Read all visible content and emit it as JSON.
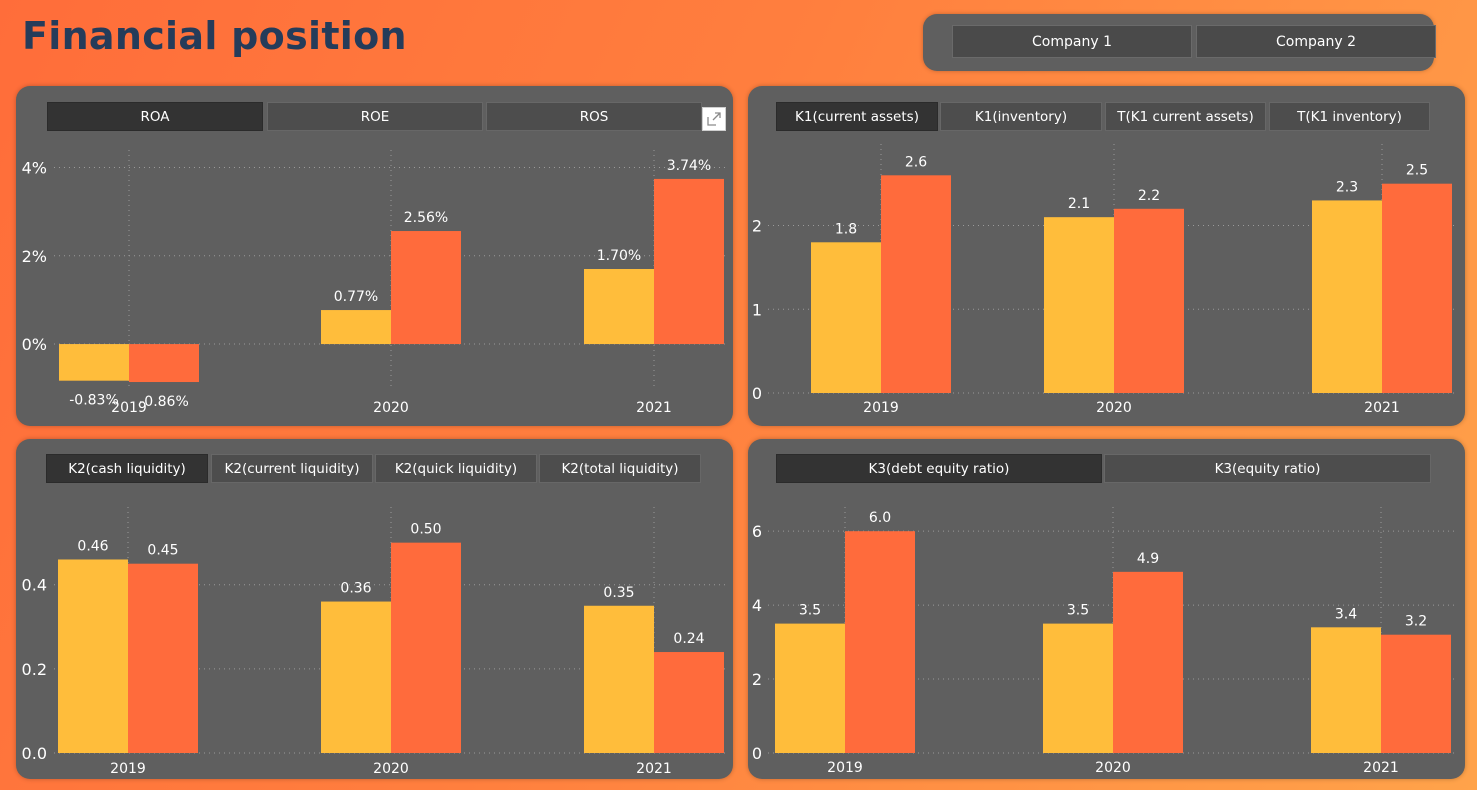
{
  "title": "Financial position",
  "company_buttons": [
    "Company 1",
    "Company 2"
  ],
  "colors": {
    "company1": "#ffbd3b",
    "company2": "#ff6b3c",
    "card": "#5f5f5f",
    "title": "#253c5a"
  },
  "cards": [
    {
      "id": "ratios",
      "tabs": [
        "ROA",
        "ROE",
        "ROS"
      ],
      "active_tab": 0,
      "has_expand": true
    },
    {
      "id": "k1",
      "tabs": [
        "K1(current assets)",
        "K1(inventory)",
        "T(K1 current assets)",
        "T(K1 inventory)"
      ],
      "active_tab": 0,
      "has_expand": false
    },
    {
      "id": "k2",
      "tabs": [
        "K2(cash liquidity)",
        "K2(current liquidity)",
        "K2(quick liquidity)",
        "K2(total liquidity)"
      ],
      "active_tab": 0,
      "has_expand": false
    },
    {
      "id": "k3",
      "tabs": [
        "K3(debt equity ratio)",
        "K3(equity ratio)"
      ],
      "active_tab": 0,
      "has_expand": false
    }
  ],
  "chart_data": [
    {
      "type": "bar",
      "categories": [
        "2019",
        "2020",
        "2021"
      ],
      "series": [
        {
          "values": [
            -0.83,
            0.77,
            1.7
          ],
          "labels": [
            "-0.83%",
            "0.77%",
            "1.70%"
          ]
        },
        {
          "values": [
            -0.86,
            2.56,
            3.74
          ],
          "labels": [
            "-0.86%",
            "2.56%",
            "3.74%"
          ]
        }
      ],
      "yticks": [
        "0%",
        "2%",
        "4%"
      ],
      "ytick_values": [
        0,
        2,
        4
      ],
      "ylim": [
        -0.95,
        4.35
      ],
      "grid": true
    },
    {
      "type": "bar",
      "categories": [
        "2019",
        "2020",
        "2021"
      ],
      "series": [
        {
          "values": [
            1.8,
            2.1,
            2.3
          ],
          "labels": [
            "1.8",
            "2.1",
            "2.3"
          ]
        },
        {
          "values": [
            2.6,
            2.2,
            2.5
          ],
          "labels": [
            "2.6",
            "2.2",
            "2.5"
          ]
        }
      ],
      "yticks": [
        "0",
        "1",
        "2"
      ],
      "ytick_values": [
        0,
        1,
        2
      ],
      "ylim": [
        0,
        2.95
      ],
      "grid": true
    },
    {
      "type": "bar",
      "categories": [
        "2019",
        "2020",
        "2021"
      ],
      "series": [
        {
          "values": [
            0.46,
            0.36,
            0.35
          ],
          "labels": [
            "0.46",
            "0.36",
            "0.35"
          ]
        },
        {
          "values": [
            0.45,
            0.5,
            0.24
          ],
          "labels": [
            "0.45",
            "0.50",
            "0.24"
          ]
        }
      ],
      "yticks": [
        "0.0",
        "0.2",
        "0.4"
      ],
      "ytick_values": [
        0,
        0.2,
        0.4
      ],
      "ylim": [
        0,
        0.58
      ],
      "grid": true
    },
    {
      "type": "bar",
      "categories": [
        "2019",
        "2020",
        "2021"
      ],
      "series": [
        {
          "values": [
            3.5,
            3.5,
            3.4
          ],
          "labels": [
            "3.5",
            "3.5",
            "3.4"
          ]
        },
        {
          "values": [
            6.0,
            4.9,
            3.2
          ],
          "labels": [
            "6.0",
            "4.9",
            "3.2"
          ]
        }
      ],
      "yticks": [
        "0",
        "2",
        "4",
        "6"
      ],
      "ytick_values": [
        0,
        2,
        4,
        6
      ],
      "ylim": [
        0,
        6.6
      ],
      "grid": true
    }
  ]
}
